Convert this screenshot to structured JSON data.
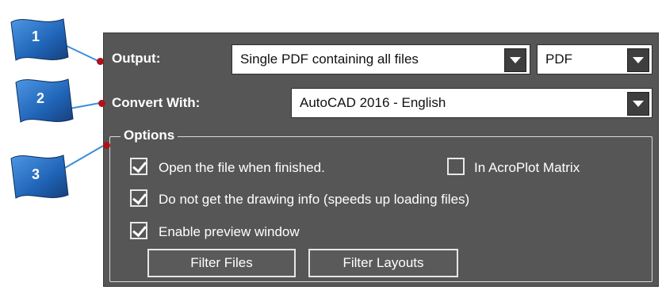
{
  "callouts": [
    {
      "number": "1"
    },
    {
      "number": "2"
    },
    {
      "number": "3"
    }
  ],
  "output": {
    "label": "Output:",
    "selected_value": "Single PDF containing all files",
    "format_value": "PDF"
  },
  "convert": {
    "label": "Convert With:",
    "selected_value": "AutoCAD 2016 - English"
  },
  "options": {
    "title": "Options",
    "open_when_finished": {
      "label": "Open the file when finished.",
      "checked": true
    },
    "in_acroplot_matrix": {
      "label": "In AcroPlot Matrix",
      "checked": false
    },
    "no_drawing_info": {
      "label": "Do not get the drawing info (speeds up loading files)",
      "checked": true
    },
    "enable_preview": {
      "label": "Enable preview window",
      "checked": true
    },
    "filter_files_label": "Filter Files",
    "filter_layouts_label": "Filter Layouts"
  },
  "colors": {
    "panel": "#565656",
    "callout_flag": "#2b74c9",
    "marker_dot": "#b0121b",
    "leader_line": "#3b8fd6"
  }
}
